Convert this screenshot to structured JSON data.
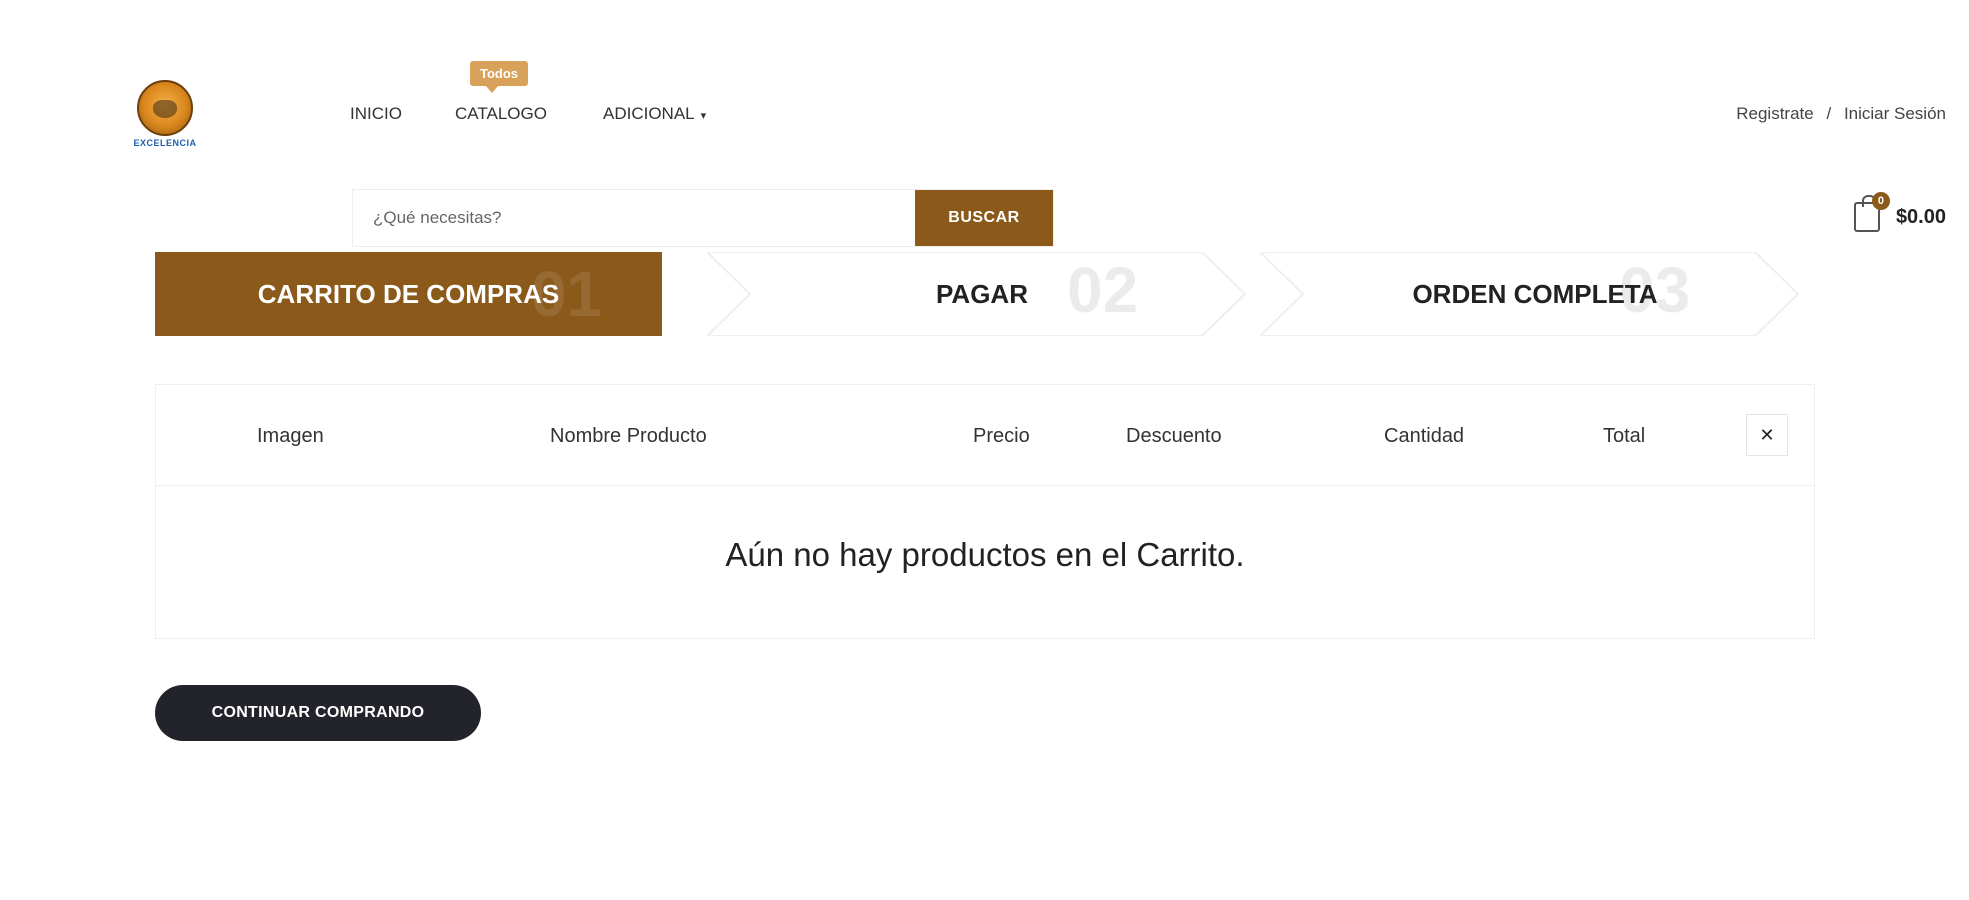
{
  "header": {
    "logo_text": "EXCELENCIA",
    "nav": [
      {
        "label": "INICIO"
      },
      {
        "label": "CATALOGO",
        "badge": "Todos"
      },
      {
        "label": "ADICIONAL"
      }
    ],
    "auth": {
      "register": "Registrate",
      "separator": "/",
      "login": "Iniciar Sesión"
    }
  },
  "search": {
    "placeholder": "¿Qué necesitas?",
    "button": "BUSCAR"
  },
  "cart": {
    "count": "0",
    "total": "$0.00"
  },
  "steps": [
    {
      "label": "CARRITO DE COMPRAS",
      "num": "01",
      "active": true
    },
    {
      "label": "PAGAR",
      "num": "02",
      "active": false
    },
    {
      "label": "ORDEN COMPLETA",
      "num": "03",
      "active": false
    }
  ],
  "table": {
    "headers": [
      "Imagen",
      "Nombre Producto",
      "Precio",
      "Descuento",
      "Cantidad",
      "Total"
    ],
    "remove_icon": "close-icon",
    "empty_message": "Aún no hay productos en el Carrito."
  },
  "continue_button": "CONTINUAR COMPRANDO",
  "colors": {
    "brand": "#8b5a1b",
    "badge": "#d9a25a",
    "dark_button": "#23242b"
  }
}
